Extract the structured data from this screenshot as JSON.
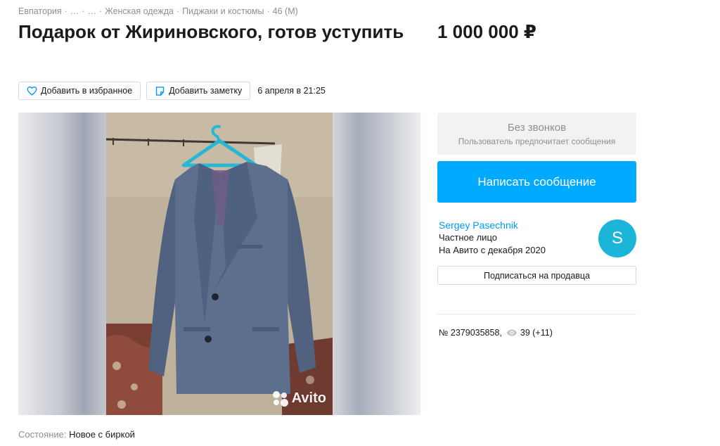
{
  "breadcrumb": [
    {
      "label": "Евпатория"
    },
    {
      "label": "…"
    },
    {
      "label": "…"
    },
    {
      "label": "Женская одежда"
    },
    {
      "label": "Пиджаки и костюмы"
    },
    {
      "label": "46 (M)"
    }
  ],
  "listing": {
    "title": "Подарок от Жириновского, готов уступить",
    "price": "1 000 000 ₽",
    "date": "6 апреля в 21:25",
    "condition_label": "Состояние:",
    "condition_value": "Новое с биркой"
  },
  "actions": {
    "favorite_label": "Добавить в избранное",
    "note_label": "Добавить заметку"
  },
  "gallery": {
    "watermark": "Avito"
  },
  "contact": {
    "no_calls_title": "Без звонков",
    "no_calls_subtitle": "Пользователь предпочитает сообщения",
    "write_label": "Написать сообщение"
  },
  "seller": {
    "name": "Sergey Pasechnik",
    "type": "Частное лицо",
    "since": "На Авито с декабря 2020",
    "avatar_letter": "S",
    "subscribe_label": "Подписаться на продавца"
  },
  "stats": {
    "number": "№ 2379035858,",
    "views": "39 (+11)"
  },
  "colors": {
    "accent": "#00aaff",
    "link": "#0099f7",
    "avatar": "#1ab5d8",
    "muted": "#8f8f8f"
  },
  "icons": [
    "heart-icon",
    "note-icon",
    "eye-icon"
  ]
}
